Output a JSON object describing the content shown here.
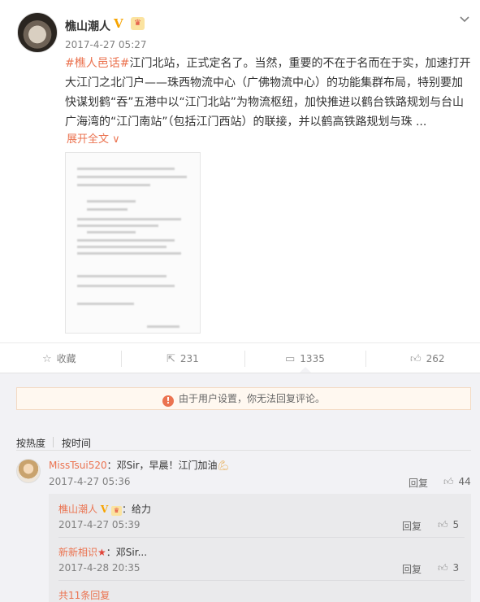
{
  "post": {
    "username": "樵山潮人",
    "verified_icon": "V",
    "member_icon": "crown-icon",
    "timestamp": "2017-4-27 05:27",
    "hashtag": "#樵人邑话#",
    "text": "江门北站，正式定名了。当然，重要的不在于名而在于实，加速打开大江门之北门户——珠西物流中心（广佛物流中心）的功能集群布局，特别要加快谋划鹤“吞”五港中以“江门北站”为物流枢纽，加快推进以鹤台铁路规划与台山广海湾的“江门南站”（包括江门西站）的联接，并以鹤高铁路规划与珠 ...",
    "expand_label": "展开全文",
    "expand_icon": "∨"
  },
  "actions": {
    "favorite_label": "收藏",
    "repost_count": "231",
    "comment_count": "1335",
    "like_count": "262"
  },
  "notice": {
    "text": "由于用户设置，你无法回复评论。",
    "icon": "!"
  },
  "sort": {
    "hot": "按热度",
    "time": "按时间"
  },
  "comments": [
    {
      "user": "MissTsui520",
      "text": "：邓Sir，早晨！江门加油",
      "emoji": "flexed-biceps-icon",
      "time": "2017-4-27 05:36",
      "reply_label": "回复",
      "likes": "44"
    }
  ],
  "replies": [
    {
      "user": "樵山潮人",
      "text": "：给力",
      "time": "2017-4-27 05:39",
      "reply_label": "回复",
      "likes": "5"
    },
    {
      "user": "新新相识",
      "text": "：邓Sir...",
      "time": "2017-4-28 20:35",
      "reply_label": "回复",
      "likes": "3"
    }
  ],
  "more_replies": "共11条回复",
  "colors": {
    "accent": "#eb7350",
    "verified": "#f7a400",
    "muted": "#808080"
  }
}
